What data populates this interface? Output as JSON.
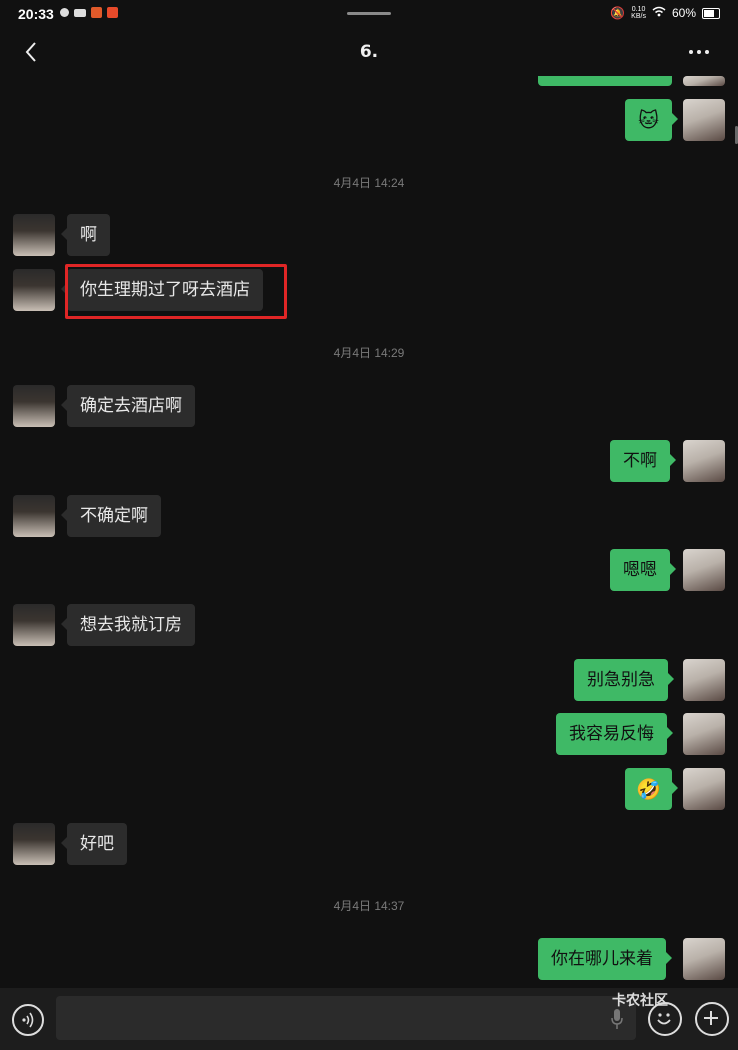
{
  "status_bar": {
    "time": "20:33",
    "net_speed": "0.10\nKB/s",
    "battery": "60%"
  },
  "header": {
    "title": "6."
  },
  "timestamps": [
    "4月4日 14:24",
    "4月4日 14:29",
    "4月4日 14:37"
  ],
  "messages": [
    {
      "from": "me",
      "type": "emoji",
      "text": "🐱"
    },
    {
      "from": "other",
      "type": "text",
      "text": "啊"
    },
    {
      "from": "other",
      "type": "text",
      "text": "你生理期过了呀去酒店",
      "highlighted": true
    },
    {
      "from": "other",
      "type": "text",
      "text": "确定去酒店啊"
    },
    {
      "from": "me",
      "type": "text",
      "text": "不啊"
    },
    {
      "from": "other",
      "type": "text",
      "text": "不确定啊"
    },
    {
      "from": "me",
      "type": "text",
      "text": "嗯嗯"
    },
    {
      "from": "other",
      "type": "text",
      "text": "想去我就订房"
    },
    {
      "from": "me",
      "type": "text",
      "text": "别急别急"
    },
    {
      "from": "me",
      "type": "text",
      "text": "我容易反悔"
    },
    {
      "from": "me",
      "type": "emoji",
      "text": "🤣"
    },
    {
      "from": "other",
      "type": "text",
      "text": "好吧"
    },
    {
      "from": "me",
      "type": "text",
      "text": "你在哪儿来着"
    }
  ],
  "input": {
    "placeholder": ""
  },
  "watermark": "卡农社区",
  "colors": {
    "background": "#111111",
    "bubble_out": "#3fb966",
    "bubble_in": "#2c2c2c",
    "highlight": "#e02626"
  }
}
